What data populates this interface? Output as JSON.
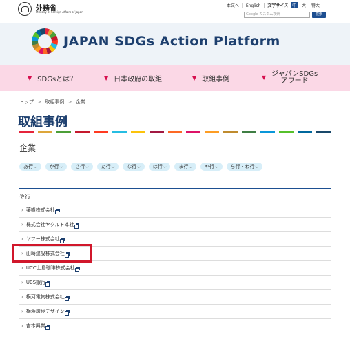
{
  "header": {
    "ministry_name": "外務省",
    "ministry_sub": "Ministry of Foreign Affairs of Japan",
    "util_links": [
      "本文へ",
      "English"
    ],
    "font_size_label": "文字サイズ",
    "font_sizes": [
      "中",
      "大",
      "特大"
    ],
    "search_placeholder": "Google カスタム検索",
    "search_button": "検索"
  },
  "brand": {
    "title": "JAPAN SDGs Action Platform"
  },
  "nav": {
    "items": [
      {
        "label": "SDGsとは？"
      },
      {
        "label": "日本政府の取組"
      },
      {
        "label": "取組事例"
      },
      {
        "label_line1": "ジャパンSDGs",
        "label_line2": "アワード"
      }
    ]
  },
  "breadcrumb": {
    "items": [
      "トップ",
      "取組事例",
      "企業"
    ]
  },
  "page": {
    "title": "取組事例",
    "section": "企業",
    "sdg_colors": [
      "#e5243b",
      "#dda63a",
      "#4c9f38",
      "#c5192d",
      "#ff3a21",
      "#26bde2",
      "#fcc30b",
      "#a21942",
      "#fd6925",
      "#dd1367",
      "#fd9d24",
      "#bf8b2e",
      "#3f7e44",
      "#0a97d9",
      "#56c02b",
      "#00689d",
      "#19486a"
    ]
  },
  "kana_filters": [
    "あ行",
    "か行",
    "さ行",
    "た行",
    "な行",
    "は行",
    "ま行",
    "や行",
    "ら行・わ行"
  ],
  "list": {
    "heading": "や行",
    "companies": [
      "薬樹株式会社",
      "株式会社ヤクルト本社",
      "ヤフー株式会社",
      "山崎建設株式会社",
      "UCC上島珈琲株式会社",
      "UBS銀行",
      "横河電気株式会社",
      "横浜環境デザイン",
      "吉本興業"
    ]
  },
  "colors": {
    "brand_navy": "#1d3f6e",
    "nav_pink": "#fbd8e6",
    "pill_blue": "#d7eef8",
    "highlight_red": "#d1172b"
  }
}
